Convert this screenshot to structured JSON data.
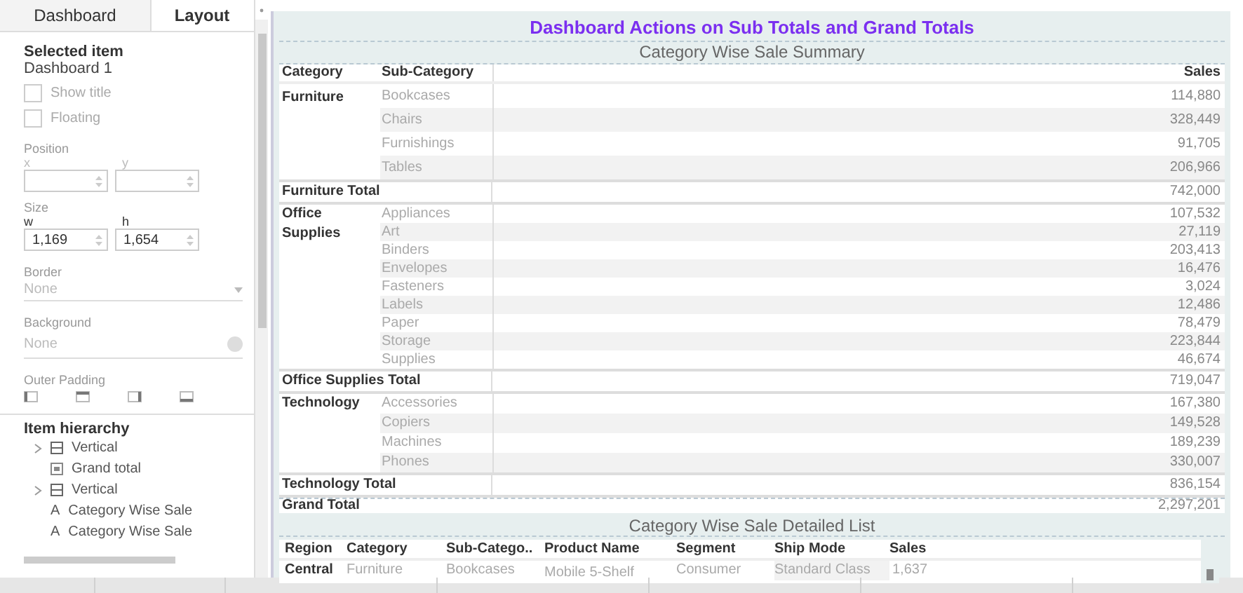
{
  "side_panel": {
    "tabs": [
      {
        "label": "Dashboard",
        "selected": false
      },
      {
        "label": "Layout",
        "selected": true
      }
    ],
    "selected_item": {
      "heading": "Selected item",
      "value": "Dashboard 1"
    },
    "checkboxes": [
      {
        "label": "Show title",
        "checked": false
      },
      {
        "label": "Floating",
        "checked": false
      }
    ],
    "position": {
      "label": "Position",
      "x_label": "x",
      "y_label": "y"
    },
    "size": {
      "label": "Size",
      "w_label": "w",
      "h_label": "h",
      "w_value": "1,169",
      "h_value": "1,654"
    },
    "border": {
      "label": "Border",
      "value": "None"
    },
    "background": {
      "label": "Background",
      "value": "None"
    },
    "outer_padding": {
      "label": "Outer Padding"
    },
    "item_hierarchy": {
      "title": "Item hierarchy",
      "items": [
        {
          "kind": "container",
          "label": "Vertical",
          "expanded": false
        },
        {
          "kind": "image",
          "label": "Grand total"
        },
        {
          "kind": "container",
          "label": "Vertical",
          "expanded": false
        },
        {
          "kind": "text",
          "glyph": "A",
          "label": "Category Wise Sale"
        },
        {
          "kind": "text",
          "glyph": "A",
          "label": "Category Wise Sale"
        }
      ]
    }
  },
  "dashboard": {
    "title": "Dashboard Actions on Sub Totals and Grand Totals",
    "summary": {
      "title": "Category Wise Sale Summary",
      "columns": [
        "Category",
        "Sub-Category",
        "Sales"
      ],
      "groups": [
        {
          "category": "Furniture",
          "rows": [
            {
              "sub": "Bookcases",
              "sales": "114,880"
            },
            {
              "sub": "Chairs",
              "sales": "328,449"
            },
            {
              "sub": "Furnishings",
              "sales": "91,705"
            },
            {
              "sub": "Tables",
              "sales": "206,966"
            }
          ],
          "total_label": "Furniture Total",
          "total": "742,000"
        },
        {
          "category": "Office Supplies",
          "rows": [
            {
              "sub": "Appliances",
              "sales": "107,532"
            },
            {
              "sub": "Art",
              "sales": "27,119"
            },
            {
              "sub": "Binders",
              "sales": "203,413"
            },
            {
              "sub": "Envelopes",
              "sales": "16,476"
            },
            {
              "sub": "Fasteners",
              "sales": "3,024"
            },
            {
              "sub": "Labels",
              "sales": "12,486"
            },
            {
              "sub": "Paper",
              "sales": "78,479"
            },
            {
              "sub": "Storage",
              "sales": "223,844"
            },
            {
              "sub": "Supplies",
              "sales": "46,674"
            }
          ],
          "total_label": "Office Supplies Total",
          "total": "719,047"
        },
        {
          "category": "Technology",
          "rows": [
            {
              "sub": "Accessories",
              "sales": "167,380"
            },
            {
              "sub": "Copiers",
              "sales": "149,528"
            },
            {
              "sub": "Machines",
              "sales": "189,239"
            },
            {
              "sub": "Phones",
              "sales": "330,007"
            }
          ],
          "total_label": "Technology Total",
          "total": "836,154"
        }
      ],
      "grand_total": {
        "label": "Grand Total",
        "value": "2,297,201"
      }
    },
    "detail": {
      "title": "Category Wise Sale Detailed List",
      "columns": [
        "Region",
        "Category",
        "Sub-Catego..",
        "Product Name",
        "Segment",
        "Ship Mode",
        "Sales"
      ],
      "rows": [
        [
          "Central",
          "Furniture",
          "Bookcases",
          "Mobile 5-Shelf",
          "Consumer",
          "Standard Class",
          "1,637"
        ]
      ]
    }
  }
}
